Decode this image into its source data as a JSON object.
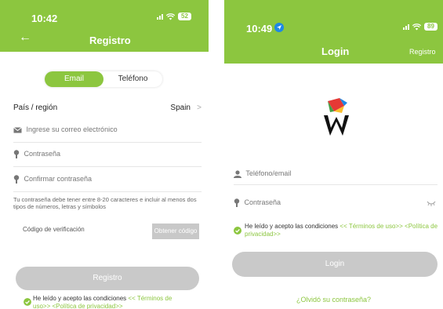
{
  "colors": {
    "accent": "#8cc63f",
    "button_disabled": "#c9c9c9"
  },
  "left": {
    "status": {
      "time": "10:42",
      "battery": "52"
    },
    "header": {
      "title": "Registro",
      "back_icon": "back-arrow-icon"
    },
    "tabs": [
      {
        "label": "Email",
        "active": true
      },
      {
        "label": "Teléfono",
        "active": false
      }
    ],
    "region": {
      "label": "País / región",
      "value": "Spain",
      "chevron": ">"
    },
    "email_placeholder": "Ingrese su correo electrónico",
    "password_placeholder": "Contraseña",
    "confirm_placeholder": "Confirmar contraseña",
    "hint": "Tu contraseña debe tener entre 8-20 caracteres e incluir al menos dos tipos de números, letras y símbolos",
    "code_placeholder": "Código de verificación",
    "code_button": "Obtener código",
    "submit_button": "Registro",
    "terms": {
      "text": "He leído y acepto las condiciones",
      "link1": "<< Términos de uso>>",
      "link2": "<Política de privacidad>>"
    }
  },
  "right": {
    "status": {
      "time": "10:49",
      "battery": "89"
    },
    "header": {
      "title": "Login",
      "link": "Registro"
    },
    "logo_letter": "W",
    "user_placeholder": "Teléfono/email",
    "password_placeholder": "Contraseña",
    "terms": {
      "text": "He leído y acepto las condiciones",
      "link1": "<< Términos de uso>>",
      "link2": "<Política de privacidad>>"
    },
    "login_button": "Login",
    "forgot": "¿Olvidó su contraseña?"
  }
}
